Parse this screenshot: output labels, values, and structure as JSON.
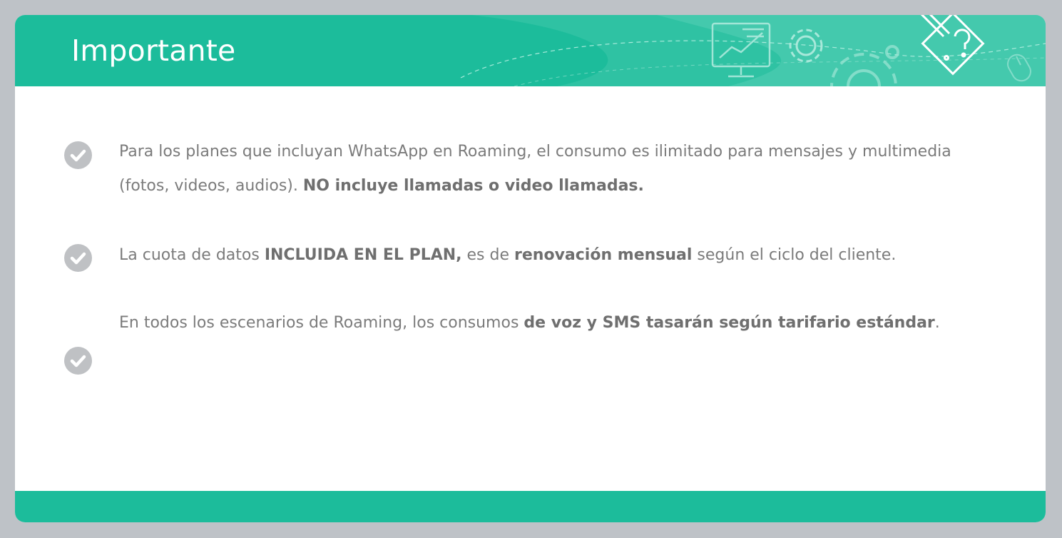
{
  "slide": {
    "title": "Importante",
    "items": [
      {
        "text_1": "Para los planes que incluyan WhatsApp en Roaming, el consumo es ilimitado para mensajes y multimedia (fotos, videos, audios). ",
        "bold_1": "NO incluye llamadas o video llamadas."
      },
      {
        "text_1": "La cuota de datos ",
        "bold_1": "INCLUIDA EN EL PLAN,",
        "text_2": " es de ",
        "bold_2": "renovación mensual",
        "text_3": " según el ciclo del cliente."
      },
      {
        "text_1": "En todos los escenarios de Roaming, los consumos ",
        "bold_1": "de voz y SMS tasarán según tarifario estándar",
        "text_2": "."
      }
    ]
  },
  "colors": {
    "accent": "#1cbc9b",
    "text": "#7b7b7b",
    "check_circle": "#bfc1c4",
    "frame": "#bec2c7"
  },
  "icons": [
    "check-circle-icon",
    "monitor-chart-icon",
    "gear-icon",
    "pencil-question-icon",
    "mouse-icon"
  ]
}
